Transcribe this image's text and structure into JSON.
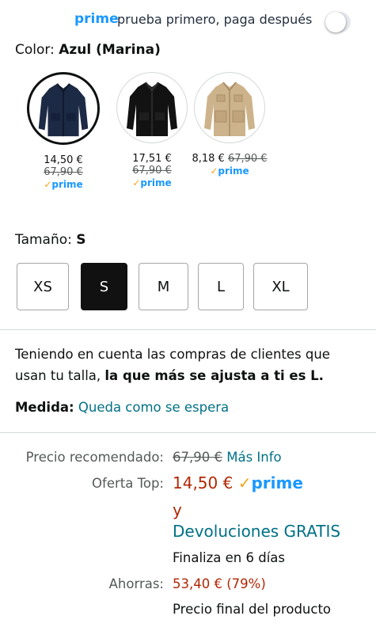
{
  "prime_banner": {
    "prime_word": "prime",
    "text": "prueba primero, paga después",
    "toggle_on": false
  },
  "color": {
    "label": "Color:",
    "selected": "Azul (Marina)",
    "options": [
      {
        "price": "14,50 €",
        "list_price": "67,90 €",
        "prime": "prime",
        "selected": true,
        "swatch_color": "#1c2a45"
      },
      {
        "price": "17,51 €",
        "list_price": "67,90 €",
        "prime": "prime",
        "selected": false,
        "swatch_color": "#121212"
      },
      {
        "price": "8,18 €",
        "list_price": "67,90 €",
        "prime": "prime",
        "selected": false,
        "swatch_color": "#cdb38b"
      }
    ]
  },
  "size": {
    "label": "Tamaño:",
    "selected": "S",
    "options": [
      "XS",
      "S",
      "M",
      "L",
      "XL"
    ]
  },
  "fit": {
    "text_part1": "Teniendo en cuenta las compras de clientes que usan tu talla,",
    "text_bold": "la que más se ajusta a ti es L.",
    "measure_label": "Medida:",
    "measure_value": "Queda como se espera"
  },
  "pricing": {
    "list_label": "Precio recomendado:",
    "list_price": "67,90 €",
    "more_info": "Más Info",
    "deal_label": "Oferta Top:",
    "deal_price": "14,50 €",
    "prime": "prime",
    "and": "y",
    "returns": "Devoluciones GRATIS",
    "ends": "Finaliza en 6 días",
    "savings_label": "Ahorras:",
    "savings": "53,40 € (79%)",
    "final_price_note": "Precio final del producto"
  }
}
